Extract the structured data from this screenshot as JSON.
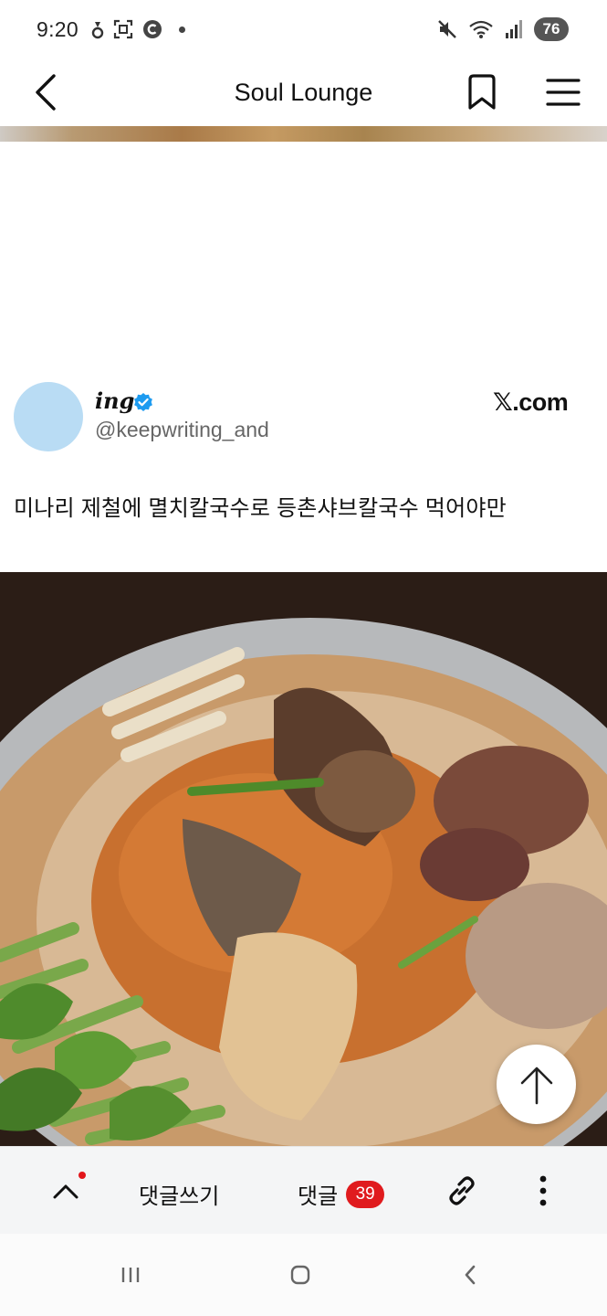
{
  "status_bar": {
    "time": "9:20",
    "battery": "76",
    "left_icons": [
      "sync-icon",
      "screenshot-icon",
      "c-circle-icon",
      "dot-icon"
    ],
    "right_icons": [
      "mute-icon",
      "wifi-icon",
      "signal-icon",
      "battery-icon"
    ]
  },
  "header": {
    "title": "Soul Lounge"
  },
  "tweet": {
    "display_name": "ing",
    "handle": "@keepwriting_and",
    "brand": "𝕏.com",
    "text": "미나리 제철에 멸치칼국수로 등촌샤브칼국수 먹어야만"
  },
  "action_bar": {
    "write_comment": "댓글쓰기",
    "comments_label": "댓글",
    "comment_count": "39"
  },
  "colors": {
    "badge_red": "#e01b1e",
    "verified_blue": "#1d9bf0",
    "avatar": "#b9dcf4"
  }
}
